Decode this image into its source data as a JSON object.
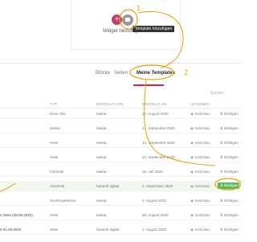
{
  "colors": {
    "accent": "#d81e5b",
    "annotation": "#e8a200",
    "insert_bg": "#5cb85c"
  },
  "top": {
    "red_icon_glyph": "+",
    "widget_label": "Widget hinzufügen",
    "tooltip": "Template hinzufügen",
    "annotation_1": "1"
  },
  "tabs": {
    "items": [
      "Blöcke",
      "Seiten",
      "Meine Templates"
    ],
    "active": "Meine Templates",
    "annotation_2": "2"
  },
  "subnote": "Suchen",
  "table": {
    "columns": [
      "Typ",
      "Erstellt von",
      "Erstellt am",
      "Aktionen"
    ],
    "rows": [
      {
        "first": "",
        "type": "Einer Abs.",
        "author": "Ialeda",
        "date": "17. August 2020",
        "preview": "Vorschau",
        "insert": "Einfügen",
        "hl": false
      },
      {
        "first": "",
        "type": "Sektor",
        "author": "Ialeda",
        "date": "21. September 2020",
        "preview": "Vorschau",
        "insert": "Einfügen",
        "hl": false
      },
      {
        "first": "",
        "type": "Seite",
        "author": "Ialeda",
        "date": "14. September 2020",
        "preview": "Vorschau",
        "insert": "Einfügen",
        "hl": false
      },
      {
        "first": "",
        "type": "Seite",
        "author": "Ialeda",
        "date": "12. September 2020",
        "preview": "Vorschau",
        "insert": "Einfügen",
        "hl": false
      },
      {
        "first": "",
        "type": "Fußzeile",
        "author": "Ialeda",
        "date": "16. Juli 2020",
        "preview": "Vorschau",
        "insert": "Einfügen",
        "hl": false
      },
      {
        "first": "",
        "type": "Abschnitt",
        "author": "haranth digital",
        "date": "4. September 2020",
        "preview": "Vorschau",
        "insert": "Einfügen",
        "hl": true
      },
      {
        "first": "",
        "type": "Suchergebnisse",
        "author": "Ialeda",
        "date": "4. August 2020",
        "preview": "Vorschau",
        "insert": "Einfügen",
        "hl": false
      },
      {
        "first": "n Seite (28.08.2020)",
        "type": "Seite",
        "author": "Ialeda",
        "date": "28. August 2020",
        "preview": "Vorschau",
        "insert": "Einfügen",
        "hl": false
      },
      {
        "first": "e 01.08.2020",
        "type": "Seite",
        "author": "haranth digital",
        "date": "1. August 2020",
        "preview": "Vorschau",
        "insert": "Einfügen",
        "hl": false
      }
    ]
  }
}
